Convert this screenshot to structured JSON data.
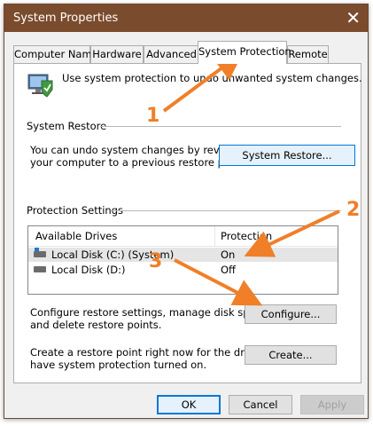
{
  "window": {
    "title": "System Properties"
  },
  "tabs": [
    {
      "label": "Computer Name"
    },
    {
      "label": "Hardware"
    },
    {
      "label": "Advanced"
    },
    {
      "label": "System Protection"
    },
    {
      "label": "Remote"
    }
  ],
  "intro": {
    "text": "Use system protection to undo unwanted system changes."
  },
  "restore": {
    "heading": "System Restore",
    "line1": "You can undo system changes by reverting",
    "line2": "your computer to a previous restore point.",
    "button": "System Restore..."
  },
  "protection": {
    "heading": "Protection Settings",
    "col_drives": "Available Drives",
    "col_protection": "Protection",
    "rows": [
      {
        "drive": "Local Disk (C:) (System)",
        "status": "On"
      },
      {
        "drive": "Local Disk (D:)",
        "status": "Off"
      }
    ]
  },
  "configure": {
    "line1": "Configure restore settings, manage disk space,",
    "line2": "and delete restore points.",
    "button": "Configure..."
  },
  "create": {
    "line1": "Create a restore point right now for the drives that",
    "line2": "have system protection turned on.",
    "button": "Create..."
  },
  "footer": {
    "ok": "OK",
    "cancel": "Cancel",
    "apply": "Apply"
  },
  "annotations": {
    "one": "1",
    "two": "2",
    "three": "3"
  },
  "colors": {
    "titlebar": "#7a4b2c",
    "annotation": "#f07f28",
    "focus": "#0078d7"
  }
}
